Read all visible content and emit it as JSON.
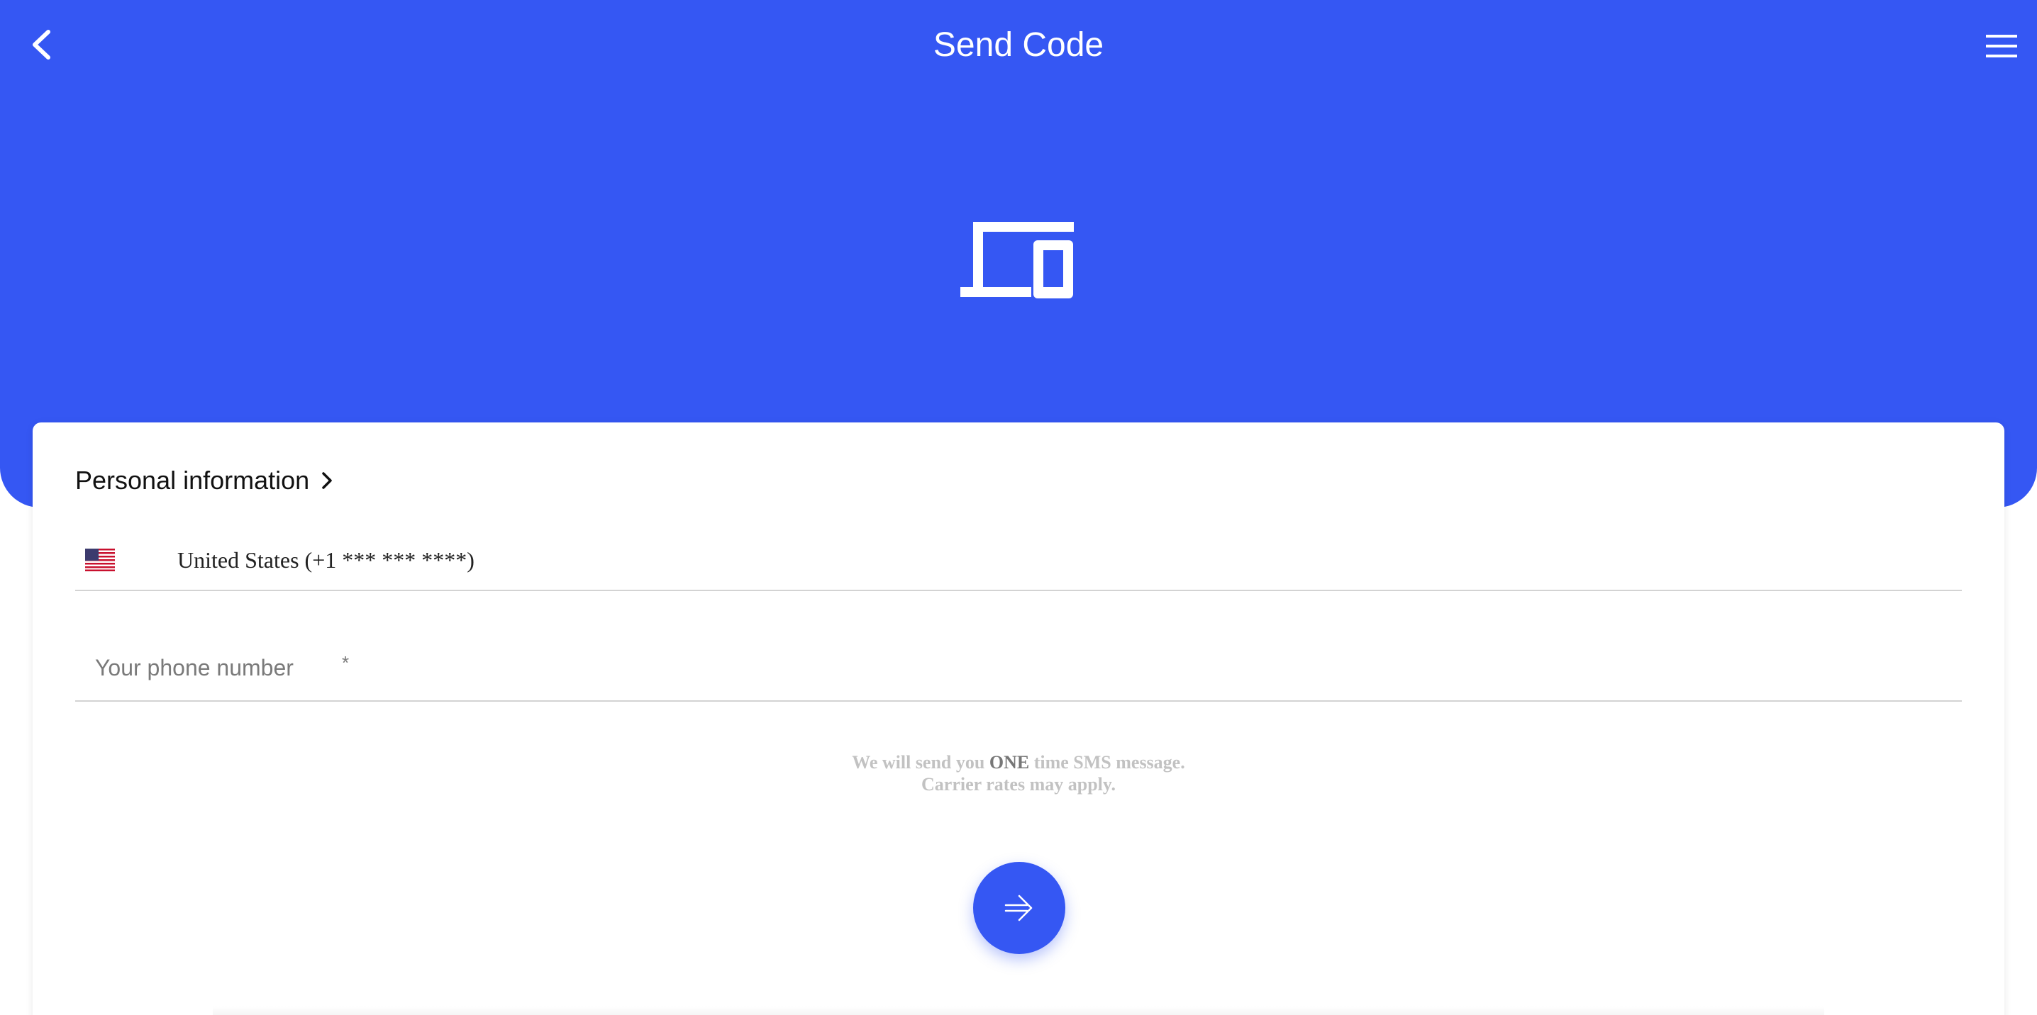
{
  "header": {
    "title": "Send Code",
    "back_icon": "chevron-left-icon",
    "menu_icon": "hamburger-menu-icon",
    "hero_icon": "devices-icon"
  },
  "colors": {
    "brand_blue": "#3557f3",
    "card_bg": "#ffffff",
    "note_gray": "#c2c2c2",
    "note_emphasis": "#777777"
  },
  "section": {
    "title": "Personal information",
    "chevron_icon": "chevron-right-icon"
  },
  "country": {
    "flag_icon": "us-flag-icon",
    "value": "United States (+1 *** *** ****)"
  },
  "phone": {
    "placeholder": "Your phone number",
    "required_mark": "*",
    "value": ""
  },
  "note": {
    "line1_prefix": "We will send you ",
    "line1_emphasis": "ONE",
    "line1_suffix": " time SMS message.",
    "line2": "Carrier rates may apply."
  },
  "submit": {
    "icon": "arrow-right-icon"
  }
}
